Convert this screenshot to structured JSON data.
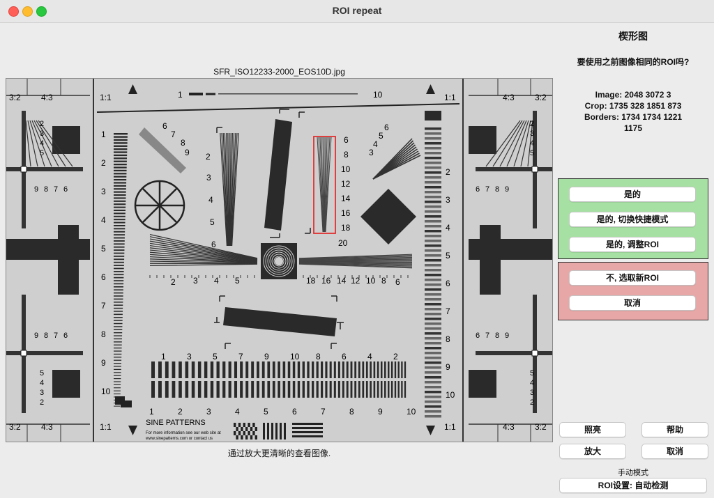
{
  "window": {
    "title": "ROI repeat"
  },
  "image": {
    "filename": "SFR_ISO12233-2000_EOS10D.jpg",
    "caption": "通过放大更清晰的查看图像."
  },
  "chart_labels": {
    "ratio_32": "3:2",
    "ratio_43": "4:3",
    "ratio_11": "1:1",
    "top_left_num": "1",
    "top_right_num": "10",
    "left_scale": [
      "1",
      "2",
      "3",
      "4",
      "5",
      "6",
      "7",
      "8",
      "9",
      "10"
    ],
    "right_scale": [
      "2",
      "3",
      "4",
      "5",
      "6",
      "7",
      "8",
      "9",
      "10"
    ],
    "roi_scale": [
      "6",
      "8",
      "10",
      "12",
      "14",
      "16",
      "18",
      "20"
    ],
    "fan_left": [
      "2",
      "3",
      "4",
      "5",
      "6"
    ],
    "fan_topleft": [
      "6",
      "7",
      "8",
      "9"
    ],
    "fan_topright": [
      "3",
      "4",
      "5",
      "6"
    ],
    "hwedge_left": [
      "2",
      "3",
      "4",
      "5"
    ],
    "hwedge_right": [
      "18",
      "16",
      "14",
      "12",
      "10",
      "8",
      "6"
    ],
    "bottom_top": [
      "1",
      "3",
      "5",
      "7",
      "9",
      "10",
      "8",
      "6",
      "4",
      "2"
    ],
    "bottom_bottom": [
      "1",
      "2",
      "3",
      "4",
      "5",
      "6",
      "7",
      "8",
      "9",
      "10"
    ],
    "side_wedge_a": [
      "2",
      "3",
      "4",
      "5"
    ],
    "side_wedge_b": [
      "9",
      "8",
      "7",
      "6"
    ],
    "side_wedge_c": [
      "6",
      "7",
      "8",
      "9"
    ],
    "sine_title": "SINE PATTERNS",
    "sine_text1": "For more information see our web site at",
    "sine_text2": "www.sinepatterns.com or contact us"
  },
  "panel": {
    "title": "楔形图",
    "question": "要使用之前图像相同的ROI吗?",
    "info_image": "Image:  2048  3072      3",
    "info_crop": "Crop:  1735   328  1851   873",
    "info_borders": "Borders:  1734  1734  1221",
    "info_borders2": "1175"
  },
  "actions_yes": {
    "yes": "是的",
    "yes_fast": "是的, 切换快捷模式",
    "yes_adjust": "是的, 调整ROI"
  },
  "actions_no": {
    "no_new": "不, 选取新ROI",
    "cancel": "取消"
  },
  "bottom": {
    "illuminate": "照亮",
    "help": "帮助",
    "zoom": "放大",
    "cancel": "取消",
    "manual_mode": "手动模式",
    "roi_setting": "ROI设置: 自动检测"
  },
  "colors": {
    "roi_box": "#e03030",
    "green_panel": "#a7e0a3",
    "red_panel": "#e7a7a7"
  }
}
